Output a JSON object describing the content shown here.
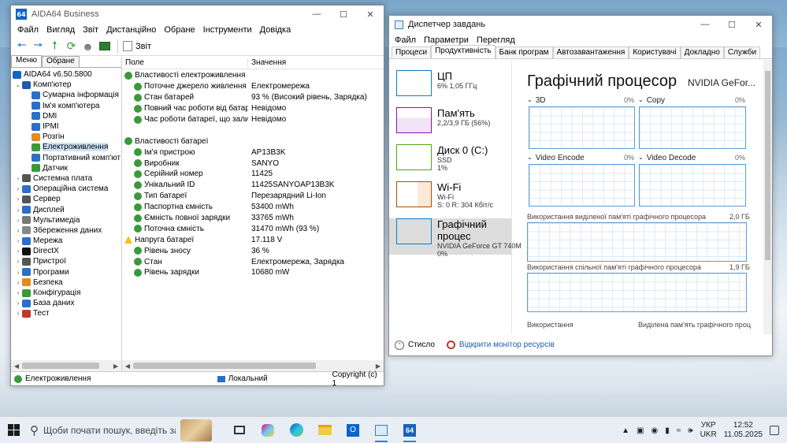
{
  "aida": {
    "title": "AIDA64 Business",
    "logo": "64",
    "menu": [
      "Файл",
      "Вигляд",
      "Звіт",
      "Дистанційно",
      "Обране",
      "Інструменти",
      "Довідка"
    ],
    "toolbar_report": "Звіт",
    "left_tabs": [
      "Меню",
      "Обране"
    ],
    "tree": [
      {
        "label": "AIDA64 v6.50.5800",
        "level": 0,
        "arrow": "",
        "icon_color": "#1565c0"
      },
      {
        "label": "Комп'ютер",
        "level": 1,
        "arrow": "⌄",
        "icon_color": "#1e5aa8"
      },
      {
        "label": "Сумарна інформація",
        "level": 2,
        "arrow": "",
        "icon_color": "#2a6fc9"
      },
      {
        "label": "Ім'я комп'ютера",
        "level": 2,
        "arrow": "",
        "icon_color": "#2a6fc9"
      },
      {
        "label": "DMI",
        "level": 2,
        "arrow": "",
        "icon_color": "#2a6fc9"
      },
      {
        "label": "IPMI",
        "level": 2,
        "arrow": "",
        "icon_color": "#2a6fc9"
      },
      {
        "label": "Розгін",
        "level": 2,
        "arrow": "",
        "icon_color": "#e58a1f"
      },
      {
        "label": "Електроживлення",
        "level": 2,
        "arrow": "",
        "icon_color": "#3a9a3a",
        "selected": true
      },
      {
        "label": "Портативний комп'ют",
        "level": 2,
        "arrow": "",
        "icon_color": "#2a6fc9"
      },
      {
        "label": "Датчик",
        "level": 2,
        "arrow": "",
        "icon_color": "#3a9a3a"
      },
      {
        "label": "Системна плата",
        "level": 1,
        "arrow": "›",
        "icon_color": "#555555"
      },
      {
        "label": "Операційна система",
        "level": 1,
        "arrow": "›",
        "icon_color": "#2a6fc9"
      },
      {
        "label": "Сервер",
        "level": 1,
        "arrow": "›",
        "icon_color": "#555555"
      },
      {
        "label": "Дисплей",
        "level": 1,
        "arrow": "›",
        "icon_color": "#2a6fc9"
      },
      {
        "label": "Мультимедіа",
        "level": 1,
        "arrow": "›",
        "icon_color": "#777777"
      },
      {
        "label": "Збереження даних",
        "level": 1,
        "arrow": "›",
        "icon_color": "#888888"
      },
      {
        "label": "Мережа",
        "level": 1,
        "arrow": "›",
        "icon_color": "#2a6fc9"
      },
      {
        "label": "DirectX",
        "level": 1,
        "arrow": "›",
        "icon_color": "#111111"
      },
      {
        "label": "Пристрої",
        "level": 1,
        "arrow": "›",
        "icon_color": "#555555"
      },
      {
        "label": "Програми",
        "level": 1,
        "arrow": "›",
        "icon_color": "#2a6fc9"
      },
      {
        "label": "Безпека",
        "level": 1,
        "arrow": "›",
        "icon_color": "#e58a1f"
      },
      {
        "label": "Конфігурація",
        "level": 1,
        "arrow": "›",
        "icon_color": "#3a9a3a"
      },
      {
        "label": "База даних",
        "level": 1,
        "arrow": "›",
        "icon_color": "#2a6fc9"
      },
      {
        "label": "Тест",
        "level": 1,
        "arrow": "›",
        "icon_color": "#c0392b"
      }
    ],
    "columns": [
      "Поле",
      "Значення"
    ],
    "rows": [
      {
        "type": "group",
        "field": "Властивості електроживлення",
        "value": ""
      },
      {
        "type": "child",
        "field": "Поточне джерело живлення",
        "value": "Електромережа"
      },
      {
        "type": "child",
        "field": "Стан батарей",
        "value": "93 % (Високий рівень, Зарядка)"
      },
      {
        "type": "child",
        "field": "Повний час роботи від батареї",
        "value": "Невідомо"
      },
      {
        "type": "child",
        "field": "Час роботи батареї, що залиш...",
        "value": "Невідомо"
      },
      {
        "type": "spacer",
        "field": "",
        "value": ""
      },
      {
        "type": "group",
        "field": "Властивості батареї",
        "value": ""
      },
      {
        "type": "child",
        "field": "Ім'я пристрою",
        "value": "AP13B3K"
      },
      {
        "type": "child",
        "field": "Виробник",
        "value": "SANYO"
      },
      {
        "type": "child",
        "field": "Серійний номер",
        "value": "11425"
      },
      {
        "type": "child",
        "field": "Унікальний ID",
        "value": "11425SANYOAP13B3K"
      },
      {
        "type": "child",
        "field": "Тип батареї",
        "value": "Перезарядний Li-Ion"
      },
      {
        "type": "child",
        "field": "Паспортна ємність",
        "value": "53400 mWh"
      },
      {
        "type": "child",
        "field": "Ємність повної зарядки",
        "value": "33765 mWh"
      },
      {
        "type": "child",
        "field": "Поточна ємність",
        "value": "31470 mWh  (93 %)"
      },
      {
        "type": "warn",
        "field": "Напруга батареї",
        "value": "17.118 V"
      },
      {
        "type": "child",
        "field": "Рівень зносу",
        "value": "36 %"
      },
      {
        "type": "child",
        "field": "Стан",
        "value": "Електромережа, Зарядка"
      },
      {
        "type": "child",
        "field": "Рівень зарядки",
        "value": "10680 mW"
      }
    ],
    "status": {
      "left": "Електроживлення",
      "mid": "Локальний",
      "right": "Copyright (c) 1"
    }
  },
  "taskmgr": {
    "title": "Диспетчер завдань",
    "menu": [
      "Файл",
      "Параметри",
      "Перегляд"
    ],
    "tabs": [
      "Процеси",
      "Продуктивність",
      "Банк програм",
      "Автозавантаження",
      "Користувачі",
      "Докладно",
      "Служби"
    ],
    "resources": [
      {
        "name": "ЦП",
        "detail": "6% 1,05 ГГц",
        "detail2": "",
        "color": "#117dbb"
      },
      {
        "name": "Пам'ять",
        "detail": "2,2/3,9 ГБ (56%)",
        "detail2": "",
        "color": "#8b12ae"
      },
      {
        "name": "Диск 0 (C:)",
        "detail": "SSD",
        "detail2": "1%",
        "color": "#4da60c"
      },
      {
        "name": "Wi-Fi",
        "detail": "Wi-Fi",
        "detail2": "S: 0 R: 304 Кбіт/с",
        "color": "#a74f01"
      },
      {
        "name": "Графічний процес",
        "detail": "NVIDIA GeForce GT 740M",
        "detail2": "0%",
        "color": "#117dbb",
        "selected": true
      }
    ],
    "gpu_title": "Графічний процесор",
    "gpu_name": "NVIDIA GeFor...",
    "engines": [
      {
        "name": "3D",
        "pct": "0%"
      },
      {
        "name": "Copy",
        "pct": "0%"
      },
      {
        "name": "Video Encode",
        "pct": "0%"
      },
      {
        "name": "Video Decode",
        "pct": "0%"
      }
    ],
    "dedicated_label": "Використання виділеної пам'яті графічного процесора",
    "dedicated_max": "2,0 ГБ",
    "shared_label": "Використання спільної пам'яті графічного процесора",
    "shared_max": "1,9 ГБ",
    "bottom_left": "Використання",
    "bottom_right": "Виділена пам'ять графічного проц",
    "footer_less": "Стисло",
    "footer_link": "Відкрити монітор ресурсів"
  },
  "taskbar": {
    "search_placeholder": "Щоби почати пошук, введіть зап",
    "lang": "УКР",
    "lang2": "UKR",
    "time": "12:52",
    "date": "11.05.2025"
  }
}
